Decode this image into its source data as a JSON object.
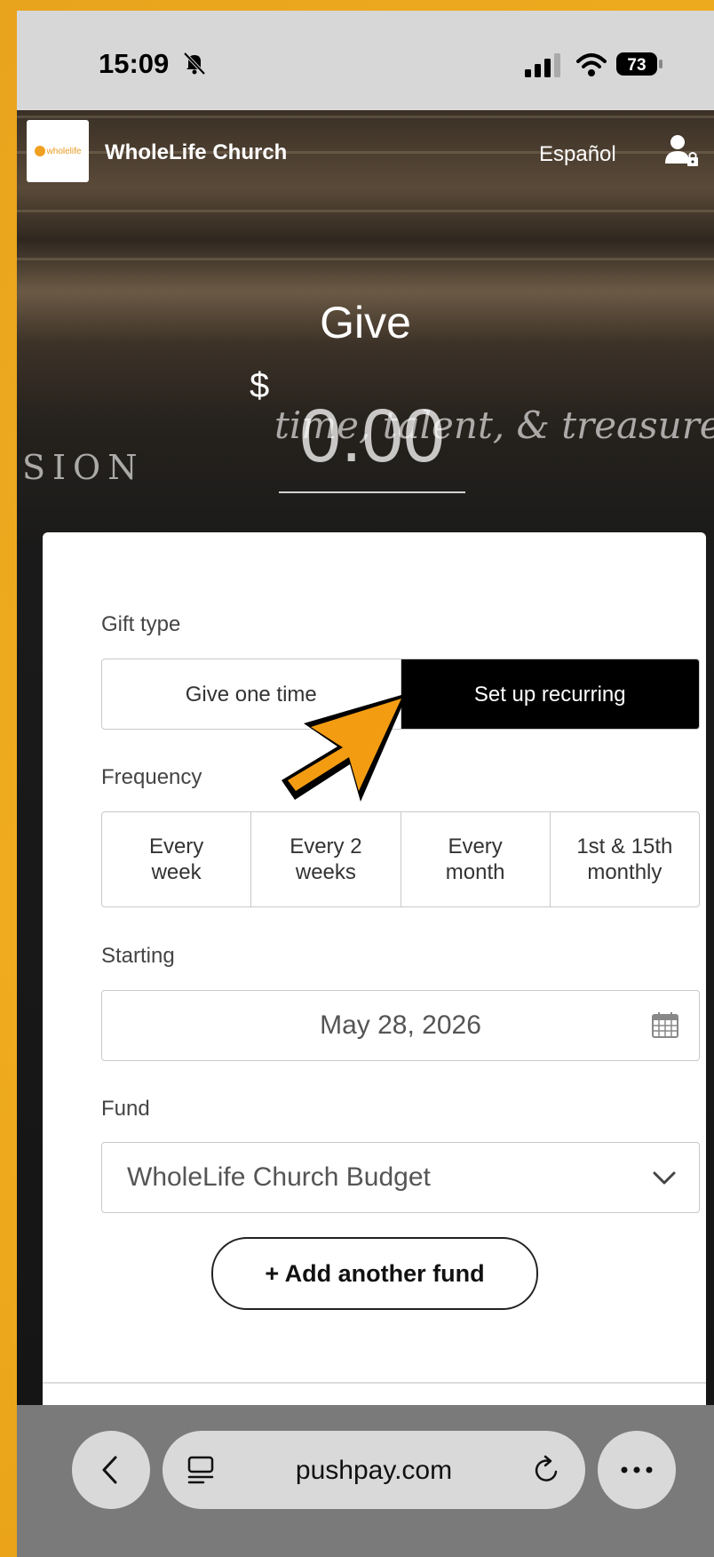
{
  "status": {
    "time": "15:09",
    "battery": "73"
  },
  "header": {
    "church_name": "WholeLife Church",
    "language_link": "Español",
    "logo_text": "wholelife"
  },
  "hero": {
    "title": "Give",
    "currency": "$",
    "amount_placeholder": "0.00",
    "chalk_1": "time, talent, & treasure",
    "chalk_2": "SION"
  },
  "gift_type": {
    "label": "Gift type",
    "options": [
      "Give one time",
      "Set up recurring"
    ],
    "selected": "Set up recurring"
  },
  "frequency": {
    "label": "Frequency",
    "options": [
      {
        "line1": "Every",
        "line2": "week"
      },
      {
        "line1": "Every 2",
        "line2": "weeks"
      },
      {
        "line1": "Every",
        "line2": "month"
      },
      {
        "line1": "1st & 15th",
        "line2": "monthly"
      }
    ]
  },
  "starting": {
    "label": "Starting",
    "value": "May 28, 2026"
  },
  "fund": {
    "label": "Fund",
    "value": "WholeLife Church Budget"
  },
  "add_fund_label": "+ Add another fund",
  "browser": {
    "url": "pushpay.com"
  },
  "colors": {
    "accent": "#000000",
    "arrow": "#f39c12",
    "background": "#e8a41d"
  }
}
